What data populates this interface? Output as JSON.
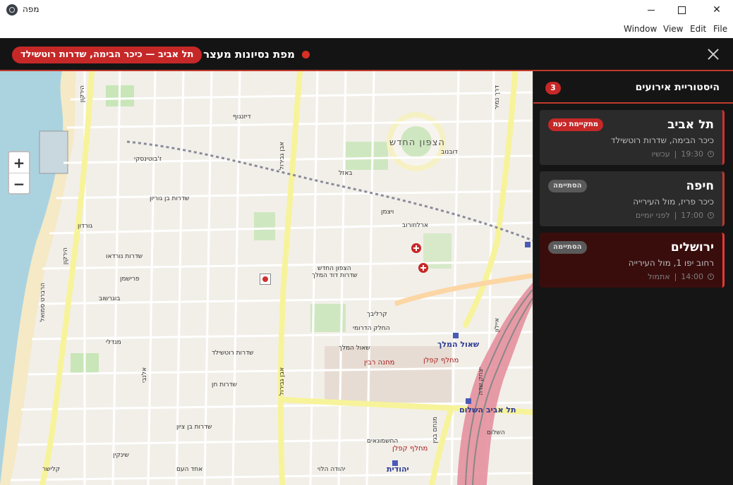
{
  "window": {
    "title": "מפה",
    "menu": [
      "File",
      "Edit",
      "View",
      "Window"
    ]
  },
  "header": {
    "title": "מפת נסיונות מעצר",
    "location": "תל אביב — כיכר הבימה, שדרות רוטשילד"
  },
  "map": {
    "zoom_in": "+",
    "zoom_out": "−",
    "labels": {
      "tzafon_hachadash": "הצפון החדש",
      "shaul_hamelech_station": "שאול המלך",
      "kaplan_interchange": "מחלף קפלן",
      "hashalom_station": "תל אביב השלום",
      "ibn_gvirol": "אבן גבירול",
      "hayarkon": "הירקון",
      "dizengoff": "דיזנגוף",
      "yehudit": "יהודית",
      "rabin_camp": "מחנה רבין",
      "arlozorov": "ארלוזורוב",
      "rothschild": "שדרות רוטשילד",
      "ben_zion": "שדרות בן ציון",
      "king_david": "שדרות דוד המלך",
      "nordau": "שדרות נורדאו",
      "begin": "מנחם בגין",
      "shalom": "השלום",
      "hakovshim": "שדרות חן",
      "south_tzafon": "החלק הדרומי",
      "hamelech_saul": "שאול המלך",
      "ayalon": "איילון",
      "herbert": "הרברט סמואל",
      "bograshov": "בוגרשוב",
      "frishman": "פרישמן",
      "gordon": "גורדון",
      "ben_gurion": "שדרות בן גוריון",
      "ibn": "אבן גבירול",
      "basel": "באזל",
      "dubnov": "דובנוב",
      "weizmann": "ויצמן",
      "namir": "דרך נמיר",
      "sheinkin": "שינקין",
      "allenby": "אלנבי",
      "ahad_haam": "אחד העם",
      "kalisher": "קלישר",
      "carlebach": "קרליבך",
      "yehuda_halevi": "יהודה הלוי",
      "mendele": "מנדלי",
      "jabotinsky": "ז'בוטינסקי",
      "shderot_hachashmonaim": "החשמונאים",
      "yitzhak_sadeh": "יצחק שדה"
    }
  },
  "sidebar": {
    "title": "היסטוריית אירועים",
    "count": "3",
    "events": [
      {
        "city": "תל אביב",
        "badge": "מתקיימת כעת",
        "place": "כיכר הבימה, שדרות רוטשילד",
        "time": "19:30",
        "relative": "עכשיו",
        "state": "live"
      },
      {
        "city": "חיפה",
        "badge": "הסתיימה",
        "place": "כיכר פריז, מול העירייה",
        "time": "17:00",
        "relative": "לפני יומיים",
        "state": "done"
      },
      {
        "city": "ירושלים",
        "badge": "הסתיימה",
        "place": "רחוב יפו 1, מול העירייה",
        "time": "14:00",
        "relative": "אתמול",
        "state": "alert"
      }
    ]
  },
  "colors": {
    "accent": "#c62828",
    "panel": "#151515",
    "card": "#2b2b2b",
    "card_alert": "#3a0d0d"
  }
}
